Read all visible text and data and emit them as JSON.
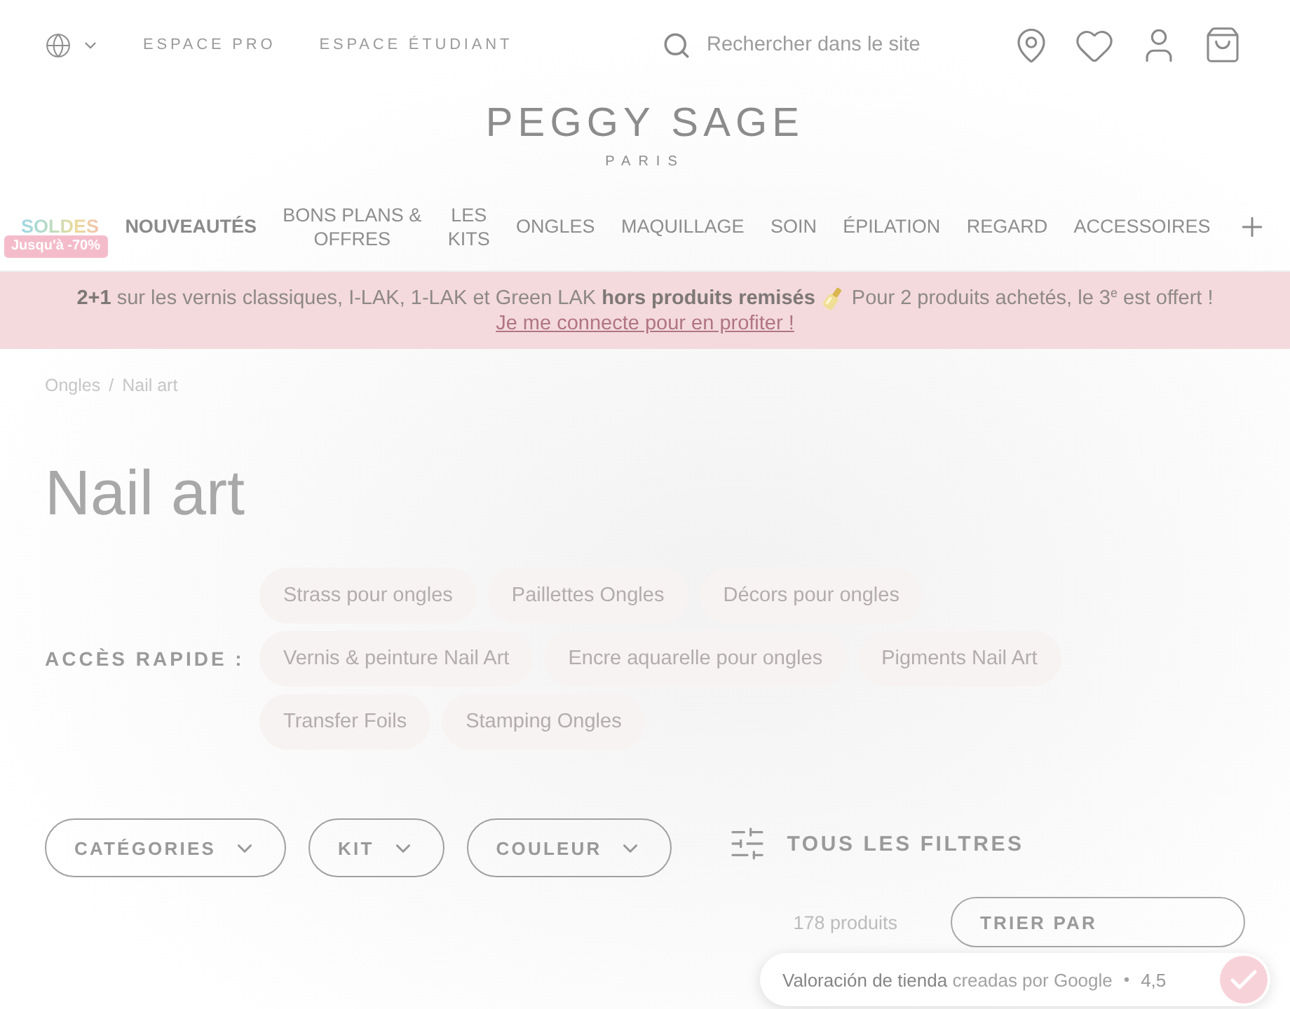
{
  "top_bar": {
    "links": [
      "ESPACE PRO",
      "ESPACE ÉTUDIANT"
    ],
    "search": {
      "placeholder": "Rechercher dans le site"
    }
  },
  "logo": {
    "name": "PEGGY SAGE",
    "subtitle": "PARIS"
  },
  "nav": {
    "items": [
      {
        "label": "SOLDES",
        "kind": "sale",
        "badge": "Jusqu'à -70%"
      },
      {
        "label": "NOUVEAUTÉS",
        "kind": "highlight"
      },
      {
        "label": "BONS PLANS &\nOFFRES",
        "kind": "plain"
      },
      {
        "label": "LES\nKITS",
        "kind": "plain"
      },
      {
        "label": "ONGLES",
        "kind": "plain"
      },
      {
        "label": "MAQUILLAGE",
        "kind": "plain"
      },
      {
        "label": "SOIN",
        "kind": "plain"
      },
      {
        "label": "ÉPILATION",
        "kind": "plain"
      },
      {
        "label": "REGARD",
        "kind": "plain"
      },
      {
        "label": "ACCESSOIRES",
        "kind": "plain"
      }
    ]
  },
  "promo_banner": {
    "text_before": "**2+1** sur les vernis classiques, I-LAK, 1-LAK et Green LAK **hors produits remisés**",
    "text_after": "Pour 2 produits achetés, le 3$^{e}$ est offert !",
    "link": "Je me connecte pour en profiter !"
  },
  "breadcrumb": {
    "items": [
      "Ongles",
      "Nail art"
    ],
    "separator": "/"
  },
  "title": "Nail art",
  "quick_access": {
    "label": "ACCÈS RAPIDE :",
    "chip_rows": [
      [
        "Strass pour ongles",
        "Paillettes Ongles",
        "Décors pour ongles"
      ],
      [
        "Vernis & peinture Nail Art",
        "Encre aquarelle pour ongles",
        "Pigments Nail Art"
      ],
      [
        "Transfer Foils",
        "Stamping Ongles"
      ]
    ]
  },
  "filters": {
    "buttons": [
      "CATÉGORIES",
      "KIT",
      "COULEUR"
    ],
    "all_filters": "TOUS LES FILTRES"
  },
  "results": {
    "count": "178 produits",
    "sort_label": "TRIER PAR"
  },
  "rating_badge": {
    "label": "**Valoración de tienda** creadas por Google",
    "separator": "•",
    "rating": "4,5"
  }
}
